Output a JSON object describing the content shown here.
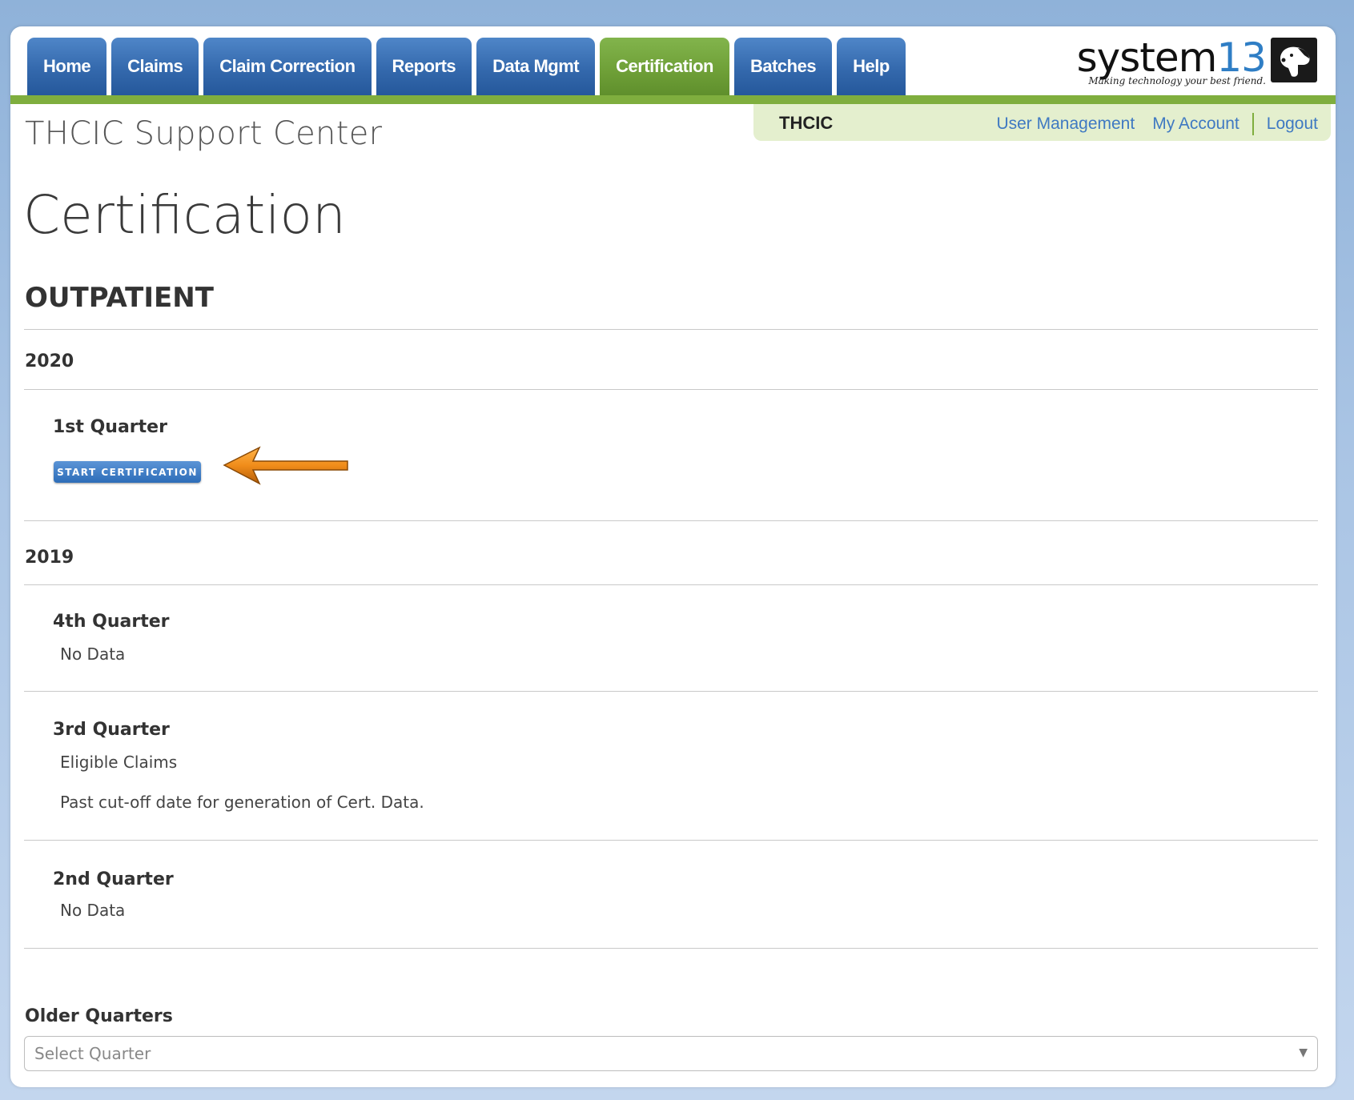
{
  "nav": {
    "tabs": [
      {
        "label": "Home",
        "active": false
      },
      {
        "label": "Claims",
        "active": false
      },
      {
        "label": "Claim Correction",
        "active": false
      },
      {
        "label": "Reports",
        "active": false
      },
      {
        "label": "Data Mgmt",
        "active": false
      },
      {
        "label": "Certification",
        "active": true
      },
      {
        "label": "Batches",
        "active": false
      },
      {
        "label": "Help",
        "active": false
      }
    ],
    "accent_color": "#7fae3e",
    "tab_color": "#3469ad"
  },
  "logo": {
    "word": "system",
    "number": "13",
    "tagline": "Making technology your best friend."
  },
  "subbar": {
    "org": "THCIC",
    "links": {
      "user_management": "User Management",
      "my_account": "My Account",
      "logout": "Logout"
    }
  },
  "site_title": "THCIC Support Center",
  "page_title": "Certification",
  "section_title": "OUTPATIENT",
  "years": {
    "y2020": {
      "label": "2020",
      "q1": {
        "label": "1st Quarter",
        "button": "START CERTIFICATION"
      }
    },
    "y2019": {
      "label": "2019",
      "q4": {
        "label": "4th Quarter",
        "text": "No Data"
      },
      "q3": {
        "label": "3rd Quarter",
        "text": "Eligible Claims",
        "note": "Past cut-off date for generation of Cert. Data."
      },
      "q2": {
        "label": "2nd Quarter",
        "text": "No Data"
      }
    }
  },
  "older": {
    "label": "Older Quarters",
    "placeholder": "Select Quarter"
  }
}
